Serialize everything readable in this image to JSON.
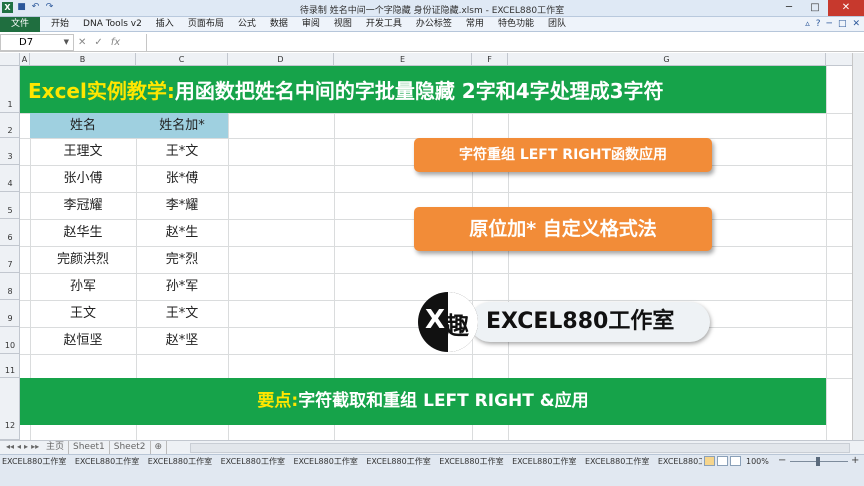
{
  "window": {
    "title": "待录制 姓名中间一个字隐藏 身份证隐藏.xlsm - EXCEL880工作室",
    "minimize": "─",
    "maximize": "□",
    "close": "✕"
  },
  "qat": {
    "save": "■",
    "undo": "↶",
    "redo": "↷"
  },
  "ribbon": {
    "tabs": [
      "文件",
      "开始",
      "DNA Tools v2",
      "插入",
      "页面布局",
      "公式",
      "数据",
      "审阅",
      "视图",
      "开发工具",
      "办公标签",
      "常用",
      "特色功能",
      "团队"
    ],
    "right_icons": [
      "▵",
      "?",
      "─",
      "□",
      "✕"
    ]
  },
  "formula_bar": {
    "name_box": "D7",
    "fx": "fx",
    "cancel": "✕",
    "enter": "✓",
    "content": ""
  },
  "columns": [
    "A",
    "B",
    "C",
    "D",
    "E",
    "F",
    "G"
  ],
  "rows": [
    "1",
    "2",
    "3",
    "4",
    "5",
    "6",
    "7",
    "8",
    "9",
    "10",
    "11",
    "12"
  ],
  "banner": {
    "part1": "Excel实例教学:",
    "part2": "用函数把姓名中间的字批量隐藏 2字和4字处理成3字符"
  },
  "table": {
    "headers": [
      "姓名",
      "姓名加*"
    ],
    "rows": [
      [
        "王理文",
        "王*文"
      ],
      [
        "张小傅",
        "张*傅"
      ],
      [
        "李冠耀",
        "李*耀"
      ],
      [
        "赵华生",
        "赵*生"
      ],
      [
        "完颜洪烈",
        "完*烈"
      ],
      [
        "孙军",
        "孙*军"
      ],
      [
        "王文",
        "王*文"
      ],
      [
        "赵恒坚",
        "赵*坚"
      ]
    ]
  },
  "buttons": {
    "btn1": "字符重组 LEFT RIGHT函数应用",
    "btn2": "原位加* 自定义格式法"
  },
  "logo": {
    "x": "X",
    "glyph": "趣",
    "text": "EXCEL880工作室"
  },
  "bottom": {
    "part1": "要点:",
    "part2": "字符截取和重组 LEFT RIGHT &应用"
  },
  "sheets": [
    "主页",
    "Sheet1",
    "Sheet2"
  ],
  "sheet_nav": [
    "◂◂",
    "◂",
    "▸",
    "▸▸"
  ],
  "status": {
    "watermark": "EXCEL880工作室",
    "zoom": "100%",
    "zoom_minus": "−",
    "zoom_plus": "+"
  },
  "colors": {
    "banner_green": "#16a34a",
    "accent_yellow": "#ffe600",
    "button_orange": "#f28c38",
    "header_blue": "#9fd0e0"
  }
}
